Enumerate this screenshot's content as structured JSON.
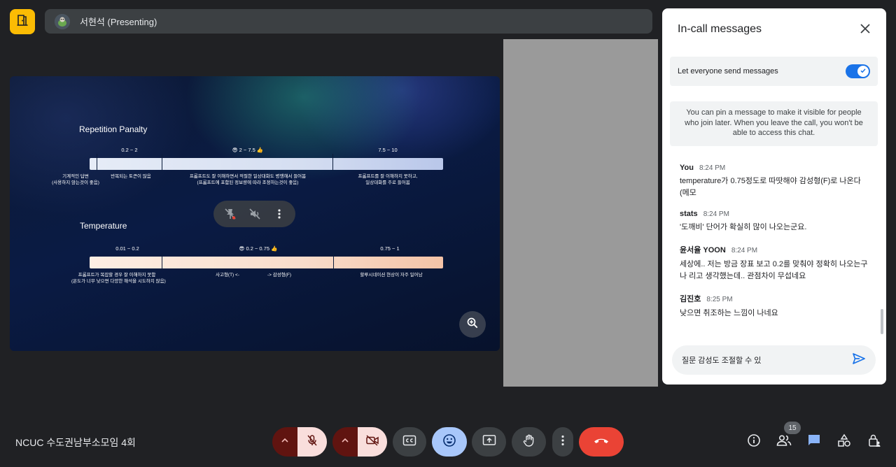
{
  "header": {
    "presenter_label": "서현석 (Presenting)"
  },
  "slide": {
    "section1": {
      "title": "Repetition Panalty",
      "ranges": [
        "0.2 ~ 2",
        "😎 2 ~ 7.5 👍",
        "7.5 ~ 10"
      ],
      "left_desc": [
        "기계적인 답변",
        "(사용하지 않는것이 좋음)"
      ],
      "desc1": "반복되는 토큰이 많음",
      "desc2": [
        "프롬프트도 잘 이해하면서 적절한 일상대화도 병행해서 들어봄",
        "(프롬프트에 포함된 정보량에 따라 조정하는것이 좋음)"
      ],
      "desc3": [
        "프롬프트를 잘 이해하지 못하고,",
        "일상대화를 주로 들어봄"
      ]
    },
    "section2": {
      "title": "Temperature",
      "ranges": [
        "0.01 ~ 0.2",
        "😎 0.2 ~ 0.75 👍",
        "0.75 ~ 1"
      ],
      "desc1": [
        "프롬프트가 복잡할 경우 잘 이해하지 못함",
        "(온도가 너무 낮으면 다양한 해석을 시도하지 않음)"
      ],
      "desc2a": "사고형(T) <-",
      "desc2b": "-> 감성형(F)",
      "desc3": "할루시네이션 현상이 자주 일어남"
    }
  },
  "chat": {
    "title": "In-call messages",
    "toggle_label": "Let everyone send messages",
    "toggle_on": true,
    "info": "You can pin a message to make it visible for people who join later. When you leave the call, you won't be able to access this chat.",
    "messages": [
      {
        "sender": "You",
        "time": "8:24 PM",
        "text": "temperature가 0.75정도로 따땃해야 감성형(F)로 나온다 (메모"
      },
      {
        "sender": "stats",
        "time": "8:24 PM",
        "text": "'도깨비' 단어가 확실히 많이 나오는군요."
      },
      {
        "sender": "윤서율 YOON",
        "time": "8:24 PM",
        "text": "세상에.. 저는 방금 장표 보고 0.2를 맞춰야 정확히 나오는구나 리고 생각했는데.. 관점차이 무섭네요"
      },
      {
        "sender": "김진호",
        "time": "8:25 PM",
        "text": "낮으면 취조하는 느낌이 나네요"
      }
    ],
    "input_value": "질문 감성도 조절할 수 있"
  },
  "footer": {
    "meeting_name": "NCUC 수도권남부소모임 4회",
    "participant_count": "15"
  },
  "colors": {
    "accent": "#1a73e8",
    "end_call": "#ea4335",
    "muted_bg": "#f9dedc",
    "muted_arrow_bg": "#601410",
    "reactions_bg": "#a8c7fa"
  }
}
